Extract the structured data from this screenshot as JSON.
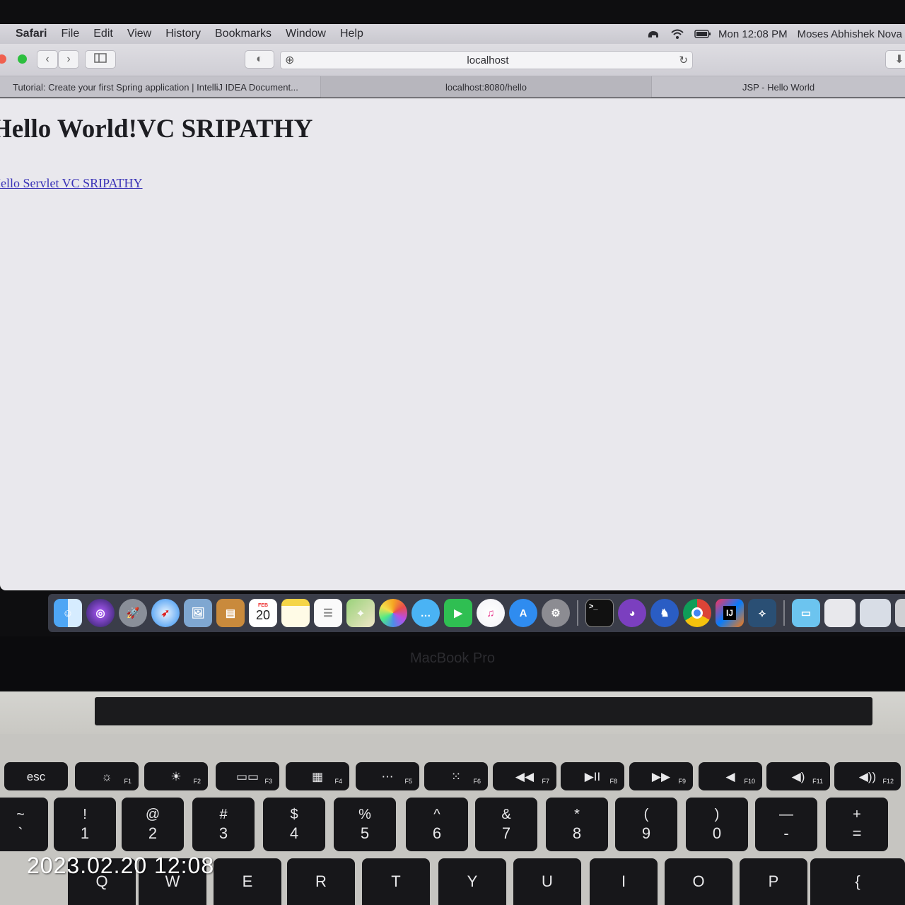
{
  "menubar": {
    "app": "Safari",
    "items": [
      "File",
      "Edit",
      "View",
      "History",
      "Bookmarks",
      "Window",
      "Help"
    ],
    "clock": "Mon 12:08 PM",
    "user": "Moses Abhishek Nova"
  },
  "toolbar": {
    "url": "localhost",
    "icons": [
      "back-icon",
      "forward-icon",
      "sidebar-icon",
      "shield-icon",
      "add-icon",
      "reload-icon"
    ]
  },
  "tabs": [
    {
      "label": "Tutorial: Create your first Spring application | IntelliJ IDEA Document..."
    },
    {
      "label": "localhost:8080/hello"
    },
    {
      "label": "JSP - Hello World"
    }
  ],
  "page": {
    "heading": "Hello World!VC SRIPATHY",
    "link": "Hello Servlet VC SRIPATHY"
  },
  "dock": {
    "calendar_month": "FEB",
    "calendar_day": "20",
    "apps": [
      "finder",
      "siri",
      "launchpad",
      "safari",
      "preview",
      "contacts",
      "calendar",
      "notes",
      "reminders",
      "maps",
      "photos",
      "messages",
      "facetime",
      "itunes",
      "app-store",
      "system-preferences",
      "terminal",
      "github-desktop",
      "sequel",
      "chrome",
      "intellij",
      "mysql-workbench",
      "downloads",
      "documents",
      "desktop",
      "trash"
    ]
  },
  "bezel_label": "MacBook Pro",
  "keyboard": {
    "fn_row": [
      {
        "label": "esc",
        "fn": ""
      },
      {
        "label": "☼",
        "fn": "F1"
      },
      {
        "label": "☀",
        "fn": "F2"
      },
      {
        "label": "▭▭",
        "fn": "F3"
      },
      {
        "label": "▦",
        "fn": "F4"
      },
      {
        "label": "⋯",
        "fn": "F5"
      },
      {
        "label": "⁙",
        "fn": "F6"
      },
      {
        "label": "◀◀",
        "fn": "F7"
      },
      {
        "label": "▶II",
        "fn": "F8"
      },
      {
        "label": "▶▶",
        "fn": "F9"
      },
      {
        "label": "◀",
        "fn": "F10"
      },
      {
        "label": "◀)",
        "fn": "F11"
      },
      {
        "label": "◀))",
        "fn": "F12"
      }
    ],
    "number_row": [
      {
        "top": "~",
        "bot": "`"
      },
      {
        "top": "!",
        "bot": "1"
      },
      {
        "top": "@",
        "bot": "2"
      },
      {
        "top": "#",
        "bot": "3"
      },
      {
        "top": "$",
        "bot": "4"
      },
      {
        "top": "%",
        "bot": "5"
      },
      {
        "top": "^",
        "bot": "6"
      },
      {
        "top": "&",
        "bot": "7"
      },
      {
        "top": "*",
        "bot": "8"
      },
      {
        "top": "(",
        "bot": "9"
      },
      {
        "top": ")",
        "bot": "0"
      },
      {
        "top": "—",
        "bot": "-"
      },
      {
        "top": "+",
        "bot": "="
      }
    ],
    "letter_row": [
      "Q",
      "W",
      "E",
      "R",
      "T",
      "Y",
      "U",
      "I",
      "O",
      "P",
      "{"
    ]
  },
  "photo_timestamp": "2023.02.20 12:08"
}
